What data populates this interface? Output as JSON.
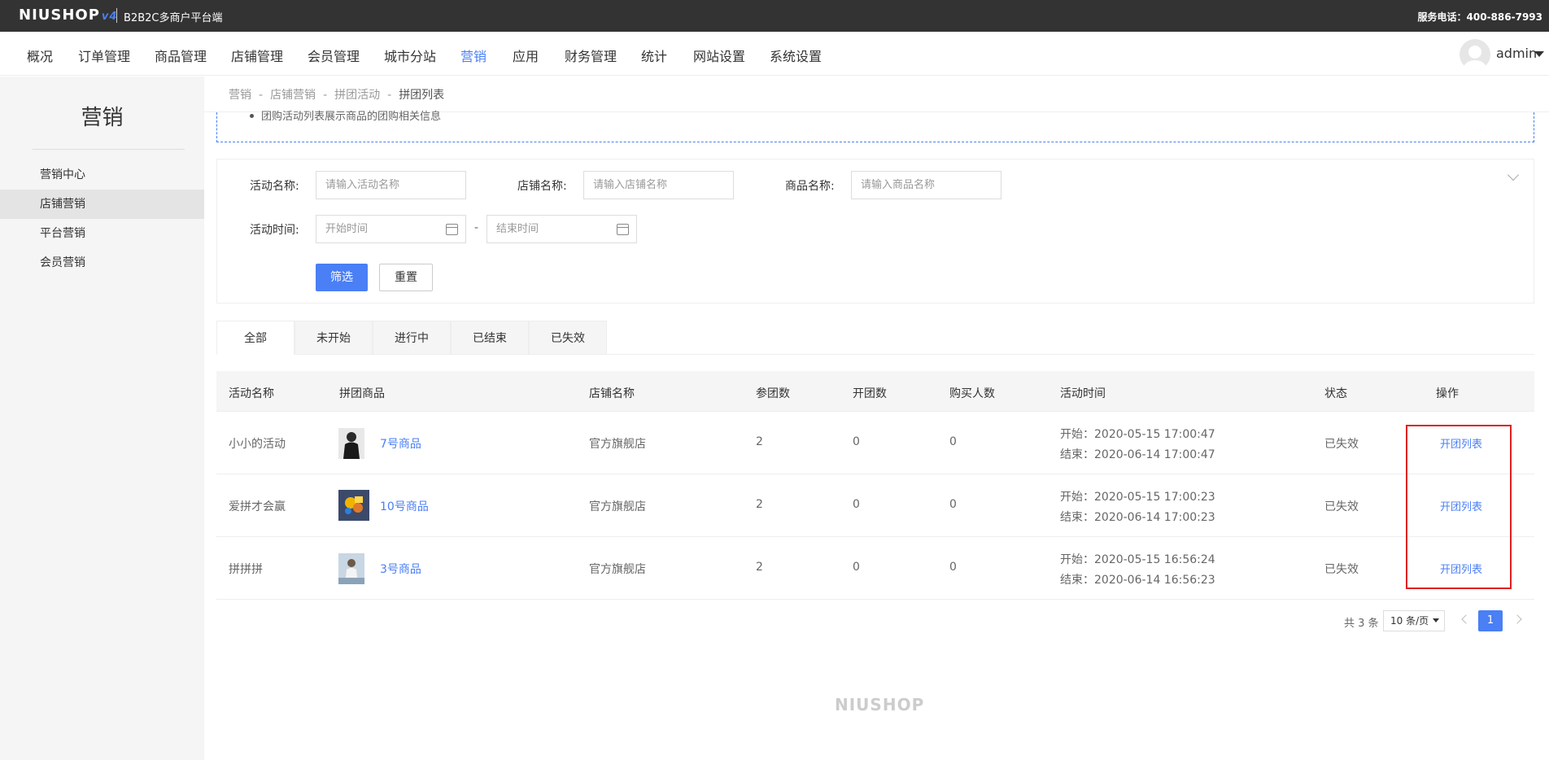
{
  "topbar": {
    "logo": "NIUSHOP",
    "logo_badge": "v4",
    "subtitle": "B2B2C多商户平台端",
    "service_phone": "服务电话：400-886-7993"
  },
  "nav": {
    "items": [
      "概况",
      "订单管理",
      "商品管理",
      "店铺管理",
      "会员管理",
      "城市分站",
      "营销",
      "应用",
      "财务管理",
      "统计",
      "网站设置",
      "系统设置"
    ],
    "active": "营销",
    "user": "admin"
  },
  "sidebar": {
    "title": "营销",
    "items": [
      "营销中心",
      "店铺营销",
      "平台营销",
      "会员营销"
    ],
    "active": "店铺营销"
  },
  "breadcrumb": {
    "items": [
      "营销",
      "店铺营销",
      "拼团活动",
      "拼团列表"
    ],
    "separator": "-"
  },
  "tip": {
    "text": "团购活动列表展示商品的团购相关信息"
  },
  "filter": {
    "activity_label": "活动名称:",
    "activity_placeholder": "请输入活动名称",
    "shop_label": "店铺名称:",
    "shop_placeholder": "请输入店铺名称",
    "goods_label": "商品名称:",
    "goods_placeholder": "请输入商品名称",
    "time_label": "活动时间:",
    "start_placeholder": "开始时间",
    "end_placeholder": "结束时间",
    "range_sep": "-",
    "search_button": "筛选",
    "reset_button": "重置"
  },
  "tabs": [
    "全部",
    "未开始",
    "进行中",
    "已结束",
    "已失效"
  ],
  "table": {
    "headers": [
      "活动名称",
      "拼团商品",
      "店铺名称",
      "参团数",
      "开团数",
      "购买人数",
      "活动时间",
      "状态",
      "操作"
    ],
    "rows": [
      {
        "name": "小小的活动",
        "goods": "7号商品",
        "shop": "官方旗舰店",
        "join": "2",
        "open": "0",
        "buyers": "0",
        "start": "开始：2020-05-15 17:00:47",
        "end": "结束：2020-06-14 17:00:47",
        "status": "已失效",
        "action": "开团列表"
      },
      {
        "name": "爱拼才会赢",
        "goods": "10号商品",
        "shop": "官方旗舰店",
        "join": "2",
        "open": "0",
        "buyers": "0",
        "start": "开始：2020-05-15 17:00:23",
        "end": "结束：2020-06-14 17:00:23",
        "status": "已失效",
        "action": "开团列表"
      },
      {
        "name": "拼拼拼",
        "goods": "3号商品",
        "shop": "官方旗舰店",
        "join": "2",
        "open": "0",
        "buyers": "0",
        "start": "开始：2020-05-15 16:56:24",
        "end": "结束：2020-06-14 16:56:23",
        "status": "已失效",
        "action": "开团列表"
      }
    ]
  },
  "pagination": {
    "total": "共 3 条",
    "page_size": "10 条/页",
    "current": "1"
  },
  "footer": {
    "logo": "NIUSHOP"
  }
}
